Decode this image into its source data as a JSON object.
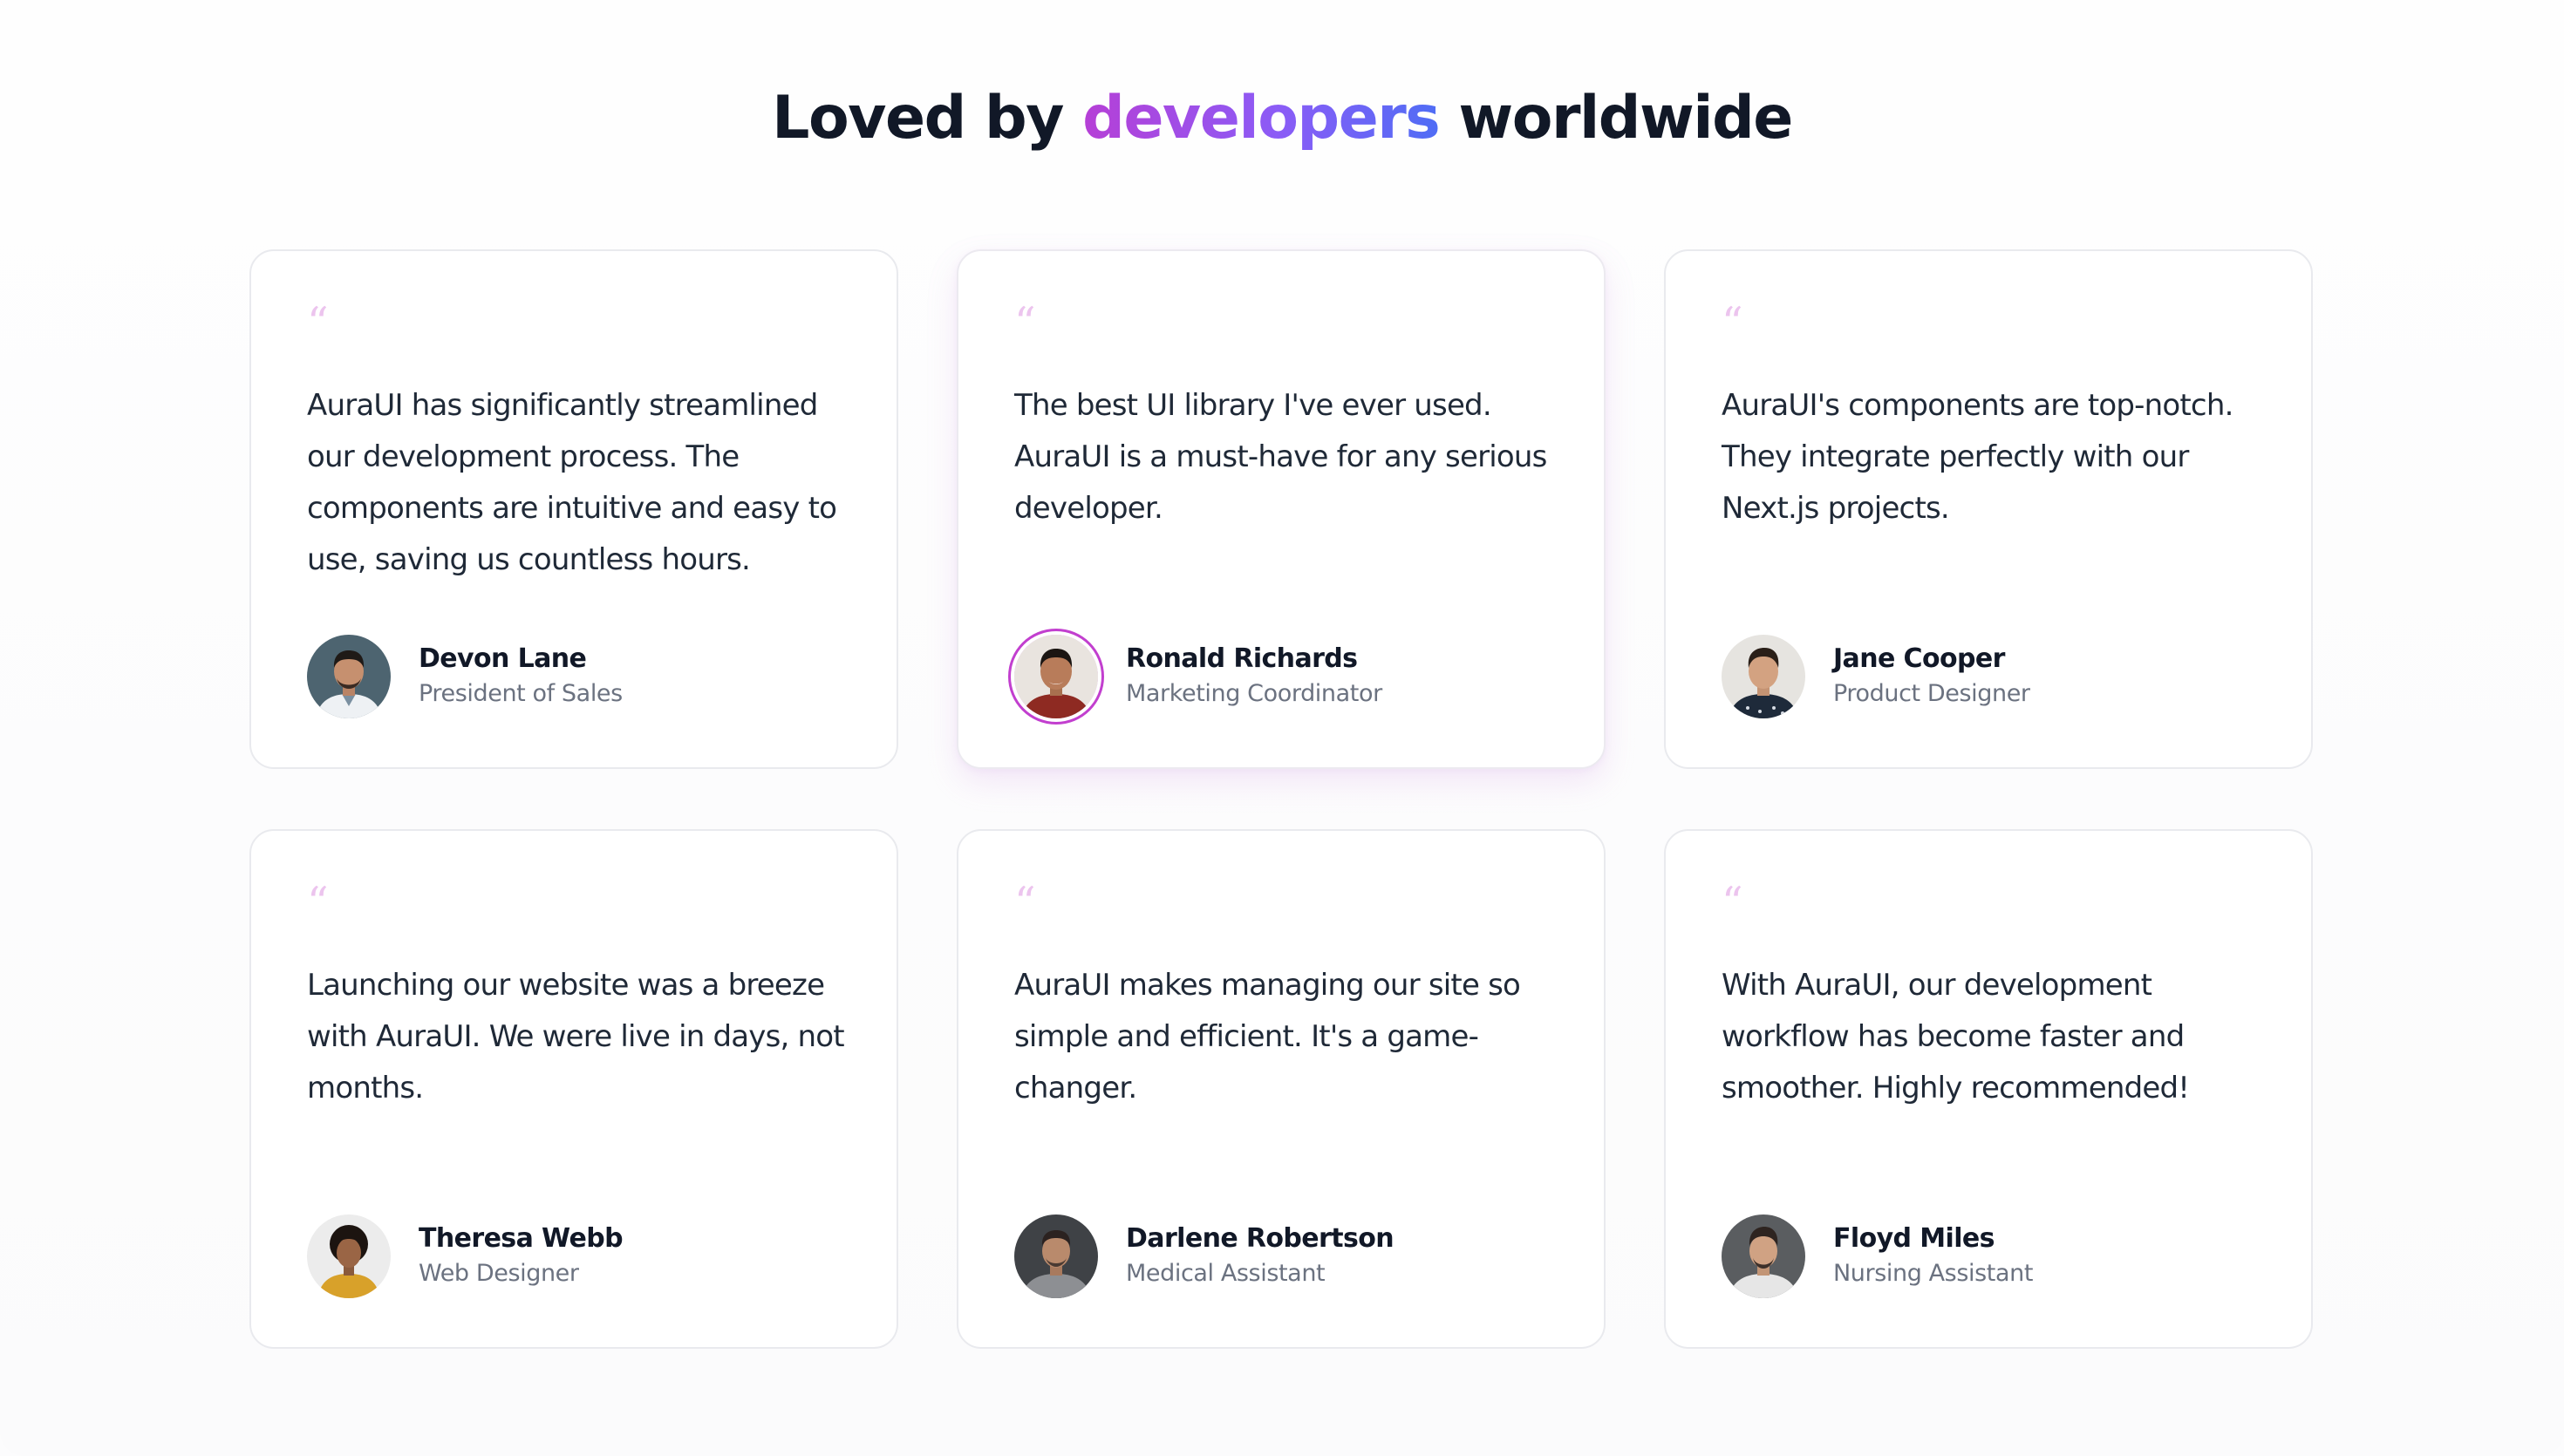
{
  "heading": {
    "prefix": "Loved by",
    "highlight": "developers",
    "suffix": "worldwide"
  },
  "quote_glyph": "“",
  "testimonials": [
    {
      "quote": "AuraUI has significantly streamlined our development process. The components are intuitive and easy to use, saving us countless hours.",
      "name": "Devon Lane",
      "role": "President of Sales",
      "avatar_icon": "person-avatar-icon"
    },
    {
      "quote": "The best UI library I've ever used. AuraUI is a must-have for any serious developer.",
      "name": "Ronald Richards",
      "role": "Marketing Coordinator",
      "avatar_icon": "person-avatar-icon",
      "highlighted": true
    },
    {
      "quote": "AuraUI's components are top-notch. They integrate perfectly with our Next.js projects.",
      "name": "Jane Cooper",
      "role": "Product Designer",
      "avatar_icon": "person-avatar-icon"
    },
    {
      "quote": "Launching our website was a breeze with AuraUI. We were live in days, not months.",
      "name": "Theresa Webb",
      "role": "Web Designer",
      "avatar_icon": "person-avatar-icon"
    },
    {
      "quote": "AuraUI makes managing our site so simple and efficient. It's a game-changer.",
      "name": "Darlene Robertson",
      "role": "Medical Assistant",
      "avatar_icon": "person-avatar-icon"
    },
    {
      "quote": "With AuraUI, our development workflow has become faster and smoother. Highly recommended!",
      "name": "Floyd Miles",
      "role": "Nursing Assistant",
      "avatar_icon": "person-avatar-icon"
    }
  ],
  "colors": {
    "heading_text": "#111827",
    "accent_gradient_start": "#b63fd6",
    "accent_gradient_end": "#4f6df5",
    "quote_mark": "#ecc4ee",
    "highlight_ring": "#c23fcf",
    "role_text": "#6b7280",
    "card_border": "#e9eaee"
  }
}
